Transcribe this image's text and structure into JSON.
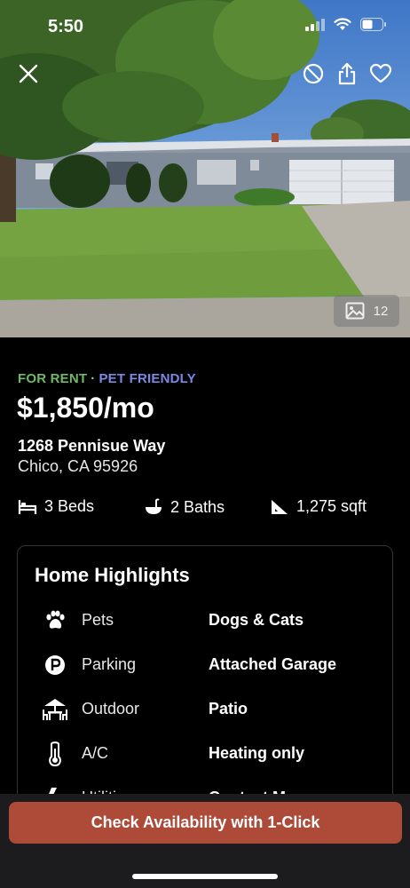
{
  "status_bar": {
    "time": "5:50"
  },
  "hero": {
    "photo_count": "12",
    "icons": [
      "close-icon",
      "hide-icon",
      "share-icon",
      "heart-icon",
      "gallery-icon"
    ]
  },
  "listing": {
    "tag_rent": "FOR RENT",
    "tag_separator": "·",
    "tag_pet": "PET FRIENDLY",
    "price": "$1,850/mo",
    "street": "1268 Pennisue Way",
    "city": "Chico, CA 95926",
    "facts": {
      "beds": "3 Beds",
      "baths": "2 Baths",
      "sqft": "1,275 sqft"
    }
  },
  "highlights": {
    "title": "Home Highlights",
    "rows": [
      {
        "label": "Pets",
        "value": "Dogs & Cats",
        "icon": "paw-icon"
      },
      {
        "label": "Parking",
        "value": "Attached Garage",
        "icon": "parking-icon"
      },
      {
        "label": "Outdoor",
        "value": "Patio",
        "icon": "patio-icon"
      },
      {
        "label": "A/C",
        "value": "Heating only",
        "icon": "thermometer-icon"
      },
      {
        "label": "Utilities",
        "value": "Contact Manager",
        "icon": "utilities-icon"
      }
    ]
  },
  "cta": {
    "label": "Check Availability with 1-Click"
  },
  "colors": {
    "for_rent": "#6dbb62",
    "pet_friendly": "#7b88e6",
    "cta": "#ad4a38",
    "background": "#000000"
  }
}
